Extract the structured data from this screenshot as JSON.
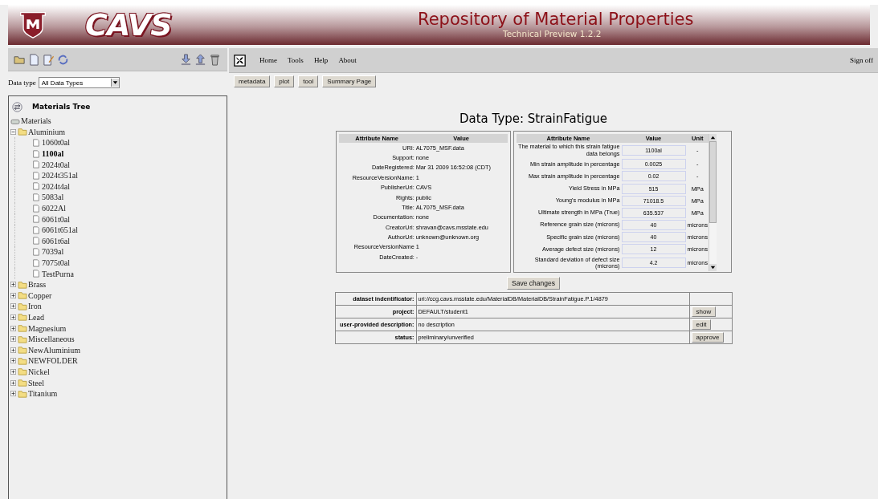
{
  "header": {
    "logo_text": "CAVS",
    "title": "Repository of Material Properties",
    "subtitle": "Technical Preview 1.2.2"
  },
  "menu": [
    "Home",
    "Tools",
    "Help",
    "About"
  ],
  "sign_off": "Sign off",
  "data_type": {
    "label": "Data type",
    "value": "All Data Types"
  },
  "tabs": [
    "metadata",
    "plot",
    "tool",
    "Summary Page"
  ],
  "tree": {
    "title": "Materials Tree",
    "root": {
      "label": "Materials",
      "selected": false,
      "children": [
        {
          "label": "Aluminium",
          "expanded": true,
          "selected": false,
          "children": [
            {
              "label": "1060t0al",
              "selected": false
            },
            {
              "label": "1100al",
              "selected": true
            },
            {
              "label": "2024t0al",
              "selected": false
            },
            {
              "label": "2024t351al",
              "selected": false
            },
            {
              "label": "2024t4al",
              "selected": false
            },
            {
              "label": "5083al",
              "selected": false
            },
            {
              "label": "6022Al",
              "selected": false
            },
            {
              "label": "6061t0al",
              "selected": false
            },
            {
              "label": "6061t651al",
              "selected": false
            },
            {
              "label": "6061t6al",
              "selected": false
            },
            {
              "label": "7039al",
              "selected": false
            },
            {
              "label": "7075t0al",
              "selected": false
            },
            {
              "label": "TestPurna",
              "selected": false
            }
          ]
        },
        {
          "label": "Brass",
          "expanded": false,
          "selected": false
        },
        {
          "label": "Copper",
          "expanded": false,
          "selected": false
        },
        {
          "label": "Iron",
          "expanded": false,
          "selected": false
        },
        {
          "label": "Lead",
          "expanded": false,
          "selected": false
        },
        {
          "label": "Magnesium",
          "expanded": false,
          "selected": false
        },
        {
          "label": "Miscellaneous",
          "expanded": false,
          "selected": false
        },
        {
          "label": "NewAluminium",
          "expanded": false,
          "selected": false
        },
        {
          "label": "NEWFOLDER",
          "expanded": false,
          "selected": false
        },
        {
          "label": "Nickel",
          "expanded": false,
          "selected": false
        },
        {
          "label": "Steel",
          "expanded": false,
          "selected": false
        },
        {
          "label": "Titanium",
          "expanded": false,
          "selected": false
        }
      ]
    }
  },
  "page_title": "Data Type: StrainFatigue",
  "metadata_table": {
    "columns": [
      "Attribute Name",
      "Value"
    ],
    "rows": [
      {
        "name": "URI:",
        "value": "AL7075_MSF.data"
      },
      {
        "name": "Support:",
        "value": "none"
      },
      {
        "name": "DateRegistered:",
        "value": "Mar 31 2009 16:52:08 (CDT)"
      },
      {
        "name": "ResourceVersionName:",
        "value": "1"
      },
      {
        "name": "PublisherUri:",
        "value": "CAVS"
      },
      {
        "name": "Rights:",
        "value": "public"
      },
      {
        "name": "Title:",
        "value": "AL7075_MSF.data"
      },
      {
        "name": "Documentation:",
        "value": "none"
      },
      {
        "name": "CreatorUri:",
        "value": "shravan@cavs.msstate.edu"
      },
      {
        "name": "AuthorUri:",
        "value": "unknown@unknown.org"
      },
      {
        "name": "ResourceVersionName",
        "value": "1"
      },
      {
        "name": "DateCreated:",
        "value": "-"
      }
    ]
  },
  "properties_table": {
    "columns": [
      "Attribute Name",
      "Value",
      "Unit"
    ],
    "rows": [
      {
        "name": "The material to which this strain fatigue data belongs",
        "value": "1100al",
        "unit": "-"
      },
      {
        "name": "Min strain amplitude in percentage",
        "value": "0.0025",
        "unit": "-"
      },
      {
        "name": "Max strain amplitude in percentage",
        "value": "0.02",
        "unit": "-"
      },
      {
        "name": "Yield Stress in MPa",
        "value": "515",
        "unit": "MPa"
      },
      {
        "name": "Young's modulus in MPa",
        "value": "71018.5",
        "unit": "MPa"
      },
      {
        "name": "Ultimate strength in MPa (True)",
        "value": "635.537",
        "unit": "MPa"
      },
      {
        "name": "Reference grain size (microns)",
        "value": "40",
        "unit": "microns"
      },
      {
        "name": "Specific grain size (microns)",
        "value": "40",
        "unit": "microns"
      },
      {
        "name": "Average defect size (microns)",
        "value": "12",
        "unit": "microns"
      },
      {
        "name": "Standard deviation of defect size (microns)",
        "value": "4.2",
        "unit": "microns"
      }
    ]
  },
  "save_button": "Save changes",
  "dataset_table": [
    {
      "label": "dataset indentificator:",
      "value": "uri://ccg.cavs.msstate.edu/MaterialDB/MaterialDB/StrainFatigue.P.1/4879"
    },
    {
      "label": "project:",
      "value": "DEFAULT/student1",
      "action": "show"
    },
    {
      "label": "user-provided description:",
      "value": "no description",
      "action": "edit"
    },
    {
      "label": "status:",
      "value": "preliminary/unverified",
      "action": "approve"
    }
  ]
}
